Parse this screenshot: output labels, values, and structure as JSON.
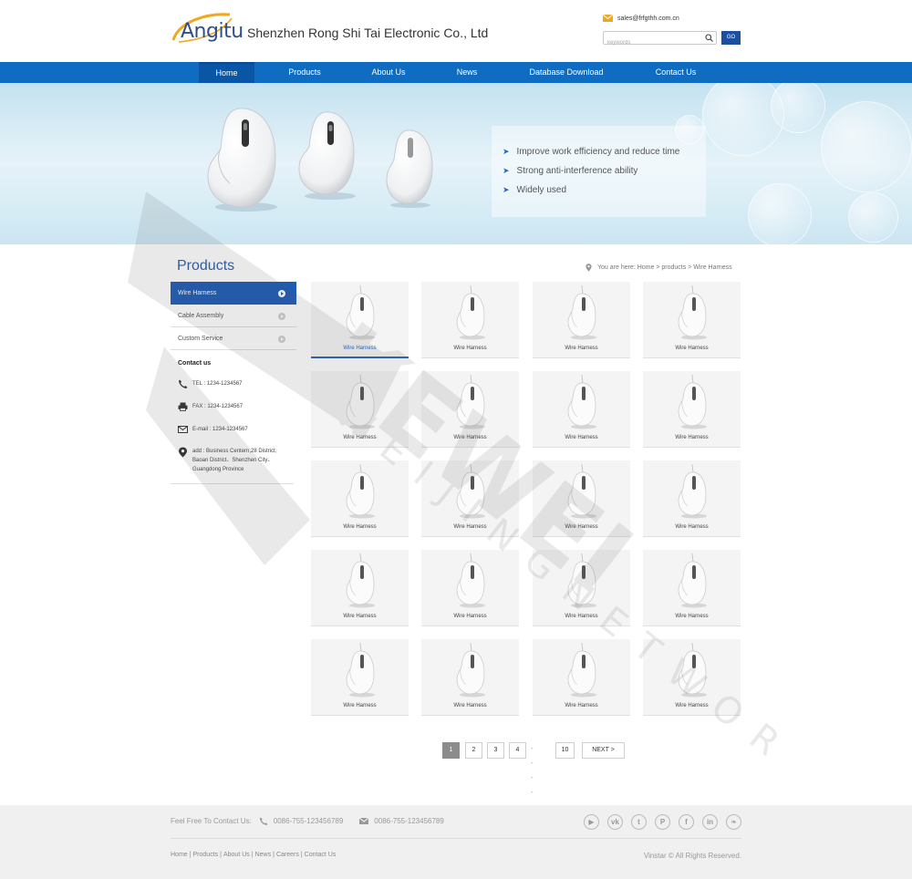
{
  "header": {
    "logo_text": "Angitu",
    "company_name": "Shenzhen Rong Shi Tai Electronic Co., Ltd",
    "email": "sales@frfgthh.com.cn",
    "search_placeholder": "keywords",
    "go_label": "GO"
  },
  "nav": {
    "items": [
      {
        "label": "Home",
        "active": true
      },
      {
        "label": "Products"
      },
      {
        "label": "About Us"
      },
      {
        "label": "News"
      },
      {
        "label": "Database Download"
      },
      {
        "label": "Contact Us"
      }
    ]
  },
  "banner": {
    "bullets": [
      "Improve work efficiency and reduce time",
      "Strong anti-interference ability",
      "Widely used"
    ]
  },
  "sidebar": {
    "title": "Products",
    "items": [
      {
        "label": "Wire Harness",
        "active": true
      },
      {
        "label": "Cable Assembly"
      },
      {
        "label": "Custom Service"
      }
    ],
    "contact": {
      "title": "Contact us",
      "tel": "TEL : 1234-1234567",
      "fax": "FAX : 1234-1234567",
      "email": "E-mail : 1234-1234567",
      "address_lines": [
        "add : Business Centern,28 District,",
        "Baoan District、Shenzhen City、",
        "Guangdong Province"
      ]
    }
  },
  "breadcrumb": {
    "text": "You are here: Home > products > Wire Harness"
  },
  "products": {
    "items": [
      "Wire Harness",
      "Wire Harness",
      "Wire Harness",
      "Wire Harness",
      "Wire Harness",
      "Wire Harness",
      "Wire Harness",
      "Wire Harness",
      "Wire Harness",
      "Wire Harness",
      "Wire Harness",
      "Wire Harness",
      "Wire Harness",
      "Wire Harness",
      "Wire Harness",
      "Wire Harness",
      "Wire Harness",
      "Wire Harness",
      "Wire Harness",
      "Wire Harness"
    ],
    "active_index": 0
  },
  "pagination": {
    "pages": [
      "1",
      "2",
      "3",
      "4"
    ],
    "dots": "- - - -",
    "last": "10",
    "next": "NEXT >",
    "current": "1"
  },
  "footer": {
    "contact_label": "Feel Free To Contact Us:",
    "phone": "0086-755-123456789",
    "fax": "0086-755-123456789",
    "social": [
      {
        "name": "youtube-icon",
        "glyph": "▶"
      },
      {
        "name": "vk-icon",
        "glyph": "vk"
      },
      {
        "name": "tumblr-icon",
        "glyph": "t"
      },
      {
        "name": "pinterest-icon",
        "glyph": "P"
      },
      {
        "name": "facebook-icon",
        "glyph": "f"
      },
      {
        "name": "linkedin-icon",
        "glyph": "in"
      },
      {
        "name": "twitter-icon",
        "glyph": "❧"
      }
    ],
    "links": [
      "Home",
      "Products",
      "About Us",
      "News",
      "Careers",
      "Contact Us"
    ],
    "copyright": "Vinstar © All Rights Reserved."
  },
  "colors": {
    "nav_blue": "#0f6cc0",
    "active_blue": "#1d5bb4",
    "title_blue": "#2d5ea8"
  }
}
